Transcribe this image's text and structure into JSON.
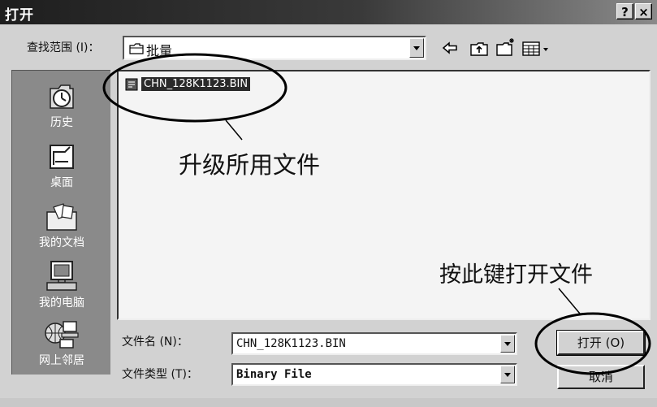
{
  "window": {
    "title": "打开",
    "help_label": "?",
    "close_label": "×"
  },
  "lookin": {
    "label": "查找范围 (I)：",
    "value": "批量"
  },
  "toolbar": {
    "icons": [
      "back-arrow-icon",
      "up-folder-icon",
      "new-folder-icon",
      "view-menu-icon"
    ]
  },
  "places": [
    {
      "label": "历史",
      "icon": "history-icon"
    },
    {
      "label": "桌面",
      "icon": "desktop-icon"
    },
    {
      "label": "我的文档",
      "icon": "my-documents-icon"
    },
    {
      "label": "我的电脑",
      "icon": "my-computer-icon"
    },
    {
      "label": "网上邻居",
      "icon": "network-neighborhood-icon"
    }
  ],
  "files": [
    {
      "name": "CHN_128K1123.BIN",
      "selected": true
    }
  ],
  "annotations": {
    "file_note": "升级所用文件",
    "button_note": "按此键打开文件"
  },
  "filename": {
    "label": "文件名 (N)：",
    "value": "CHN_128K1123.BIN"
  },
  "filetype": {
    "label": "文件类型 (T)：",
    "value": "Binary File"
  },
  "buttons": {
    "open_label": "打开 (O)",
    "cancel_label": "取消"
  },
  "colors": {
    "title_bar": "#1e1e1e",
    "face": "#d2d2d2",
    "places_bg": "#8a8a8a",
    "selection": "#2a2a2a"
  }
}
